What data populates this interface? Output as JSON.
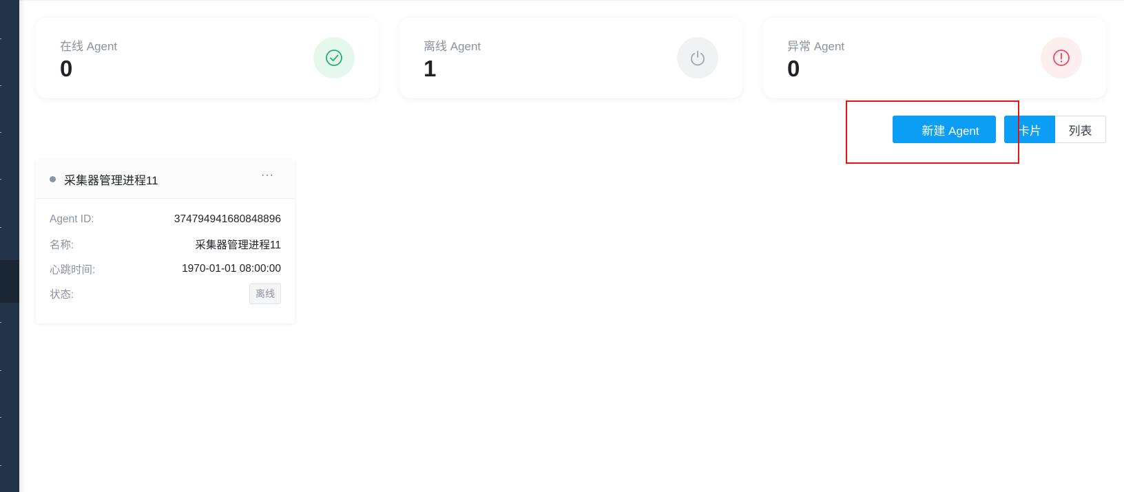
{
  "stats": [
    {
      "label": "在线 Agent",
      "value": "0",
      "icon": "check-circle-icon",
      "icon_color": "#19b36b",
      "icon_bg": "#e6f8ee"
    },
    {
      "label": "离线 Agent",
      "value": "1",
      "icon": "power-icon",
      "icon_color": "#a0a6ae",
      "icon_bg": "#f1f2f4"
    },
    {
      "label": "异常 Agent",
      "value": "0",
      "icon": "alert-circle-icon",
      "icon_color": "#f0485d",
      "icon_bg": "#fdeef0"
    }
  ],
  "toolbar": {
    "new_agent_label": "新建 Agent",
    "view_card_label": "卡片",
    "view_list_label": "列表",
    "active_view": "卡片"
  },
  "agent_card": {
    "title": "采集器管理进程11",
    "more": "···",
    "rows": [
      {
        "key": "Agent ID:",
        "value": "374794941680848896"
      },
      {
        "key": "名称:",
        "value": "采集器管理进程11"
      },
      {
        "key": "心跳时间:",
        "value": "1970-01-01 08:00:00"
      },
      {
        "key": "状态:",
        "value": "离线"
      }
    ]
  },
  "colors": {
    "primary": "#0c9df4",
    "sidebar": "#243447",
    "highlight": "#f00f0f"
  }
}
